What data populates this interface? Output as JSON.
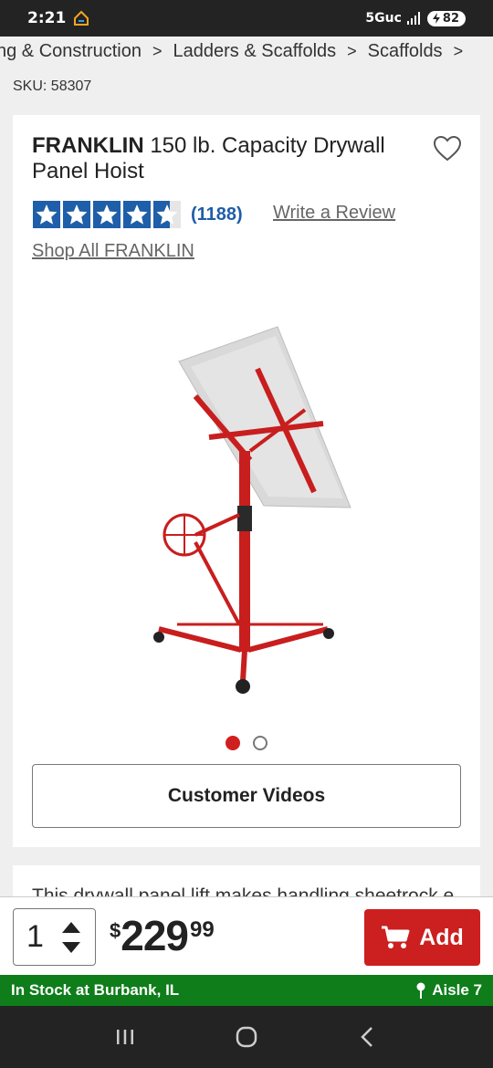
{
  "status": {
    "time": "2:21",
    "network": "5Guc",
    "battery": "82"
  },
  "breadcrumb": {
    "items": [
      "ng & Construction",
      "Ladders & Scaffolds",
      "Scaffolds"
    ]
  },
  "sku": "SKU: 58307",
  "product": {
    "brand": "FRANKLIN",
    "name": "150 lb. Capacity Drywall Panel Hoist",
    "rating": 4.5,
    "review_count": "(1188)",
    "write_review": "Write a Review",
    "shop_all": "Shop All FRANKLIN"
  },
  "gallery": {
    "dots": 2,
    "active_index": 0
  },
  "videos_button": "Customer Videos",
  "description_preview": "This drywall panel lift makes handling sheetrock e",
  "cart": {
    "quantity": "1",
    "currency": "$",
    "price_dollars": "229",
    "price_cents": "99",
    "add_label": "Add"
  },
  "stock": {
    "status": "In Stock at Burbank, IL",
    "aisle": "Aisle 7"
  },
  "colors": {
    "accent_red": "#cc1f1f",
    "star_blue": "#1f5ea8",
    "stock_green": "#0e7d1a"
  }
}
